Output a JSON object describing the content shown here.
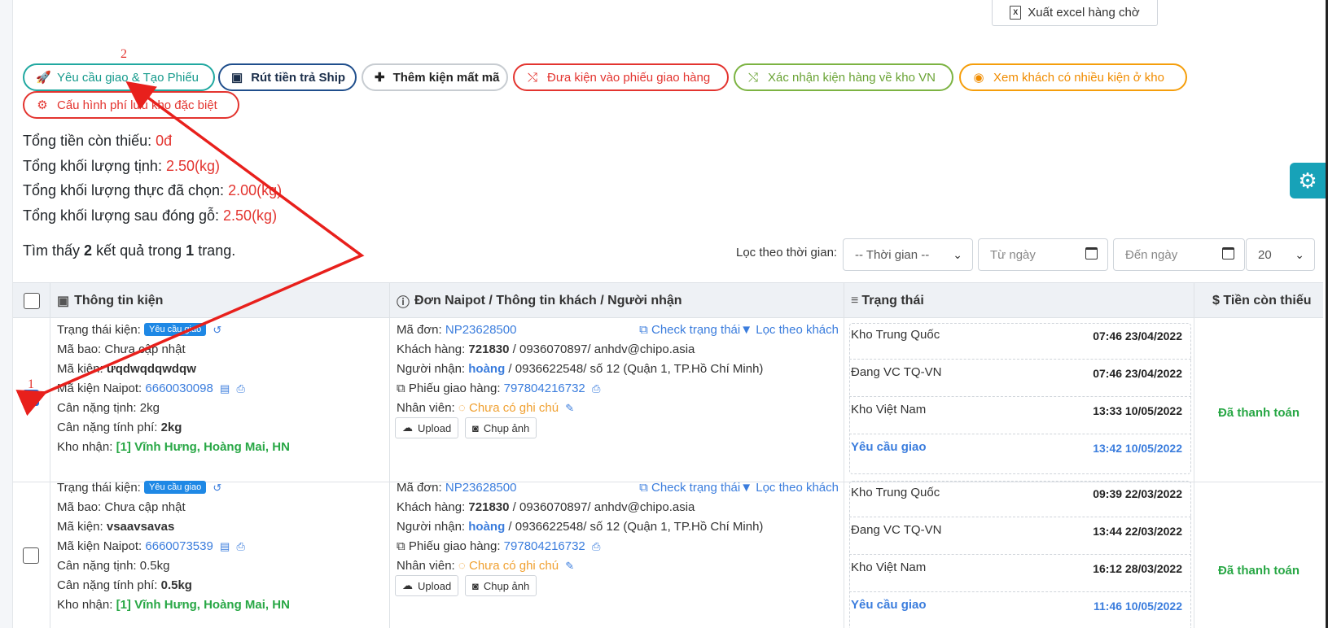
{
  "toolbar": {
    "export_label": "Xuất excel hàng chờ",
    "actions": [
      {
        "label": "Yêu cầu giao & Tạo Phiếu",
        "icon": "rocket-icon"
      },
      {
        "label": "Rút tiền trả Ship",
        "icon": "money-icon"
      },
      {
        "label": "Thêm kiện mất mã",
        "icon": "plus-icon"
      },
      {
        "label": "Đưa kiện vào phiếu giao hàng",
        "icon": "shuffle-icon"
      },
      {
        "label": "Xác nhận kiện hàng về kho VN",
        "icon": "shuffle-icon"
      },
      {
        "label": "Xem khách có nhiều kiện ở kho",
        "icon": "user-circle-icon"
      },
      {
        "label": "Cấu hình phí lưu kho đặc biệt",
        "icon": "gear-icon"
      }
    ]
  },
  "annotations": {
    "step1": "1",
    "step2": "2"
  },
  "summary": {
    "missing_label": "Tổng tiền còn thiếu:",
    "missing_value": "0đ",
    "net_label": "Tổng khối lượng tịnh:",
    "net_value": "2.50(kg)",
    "actual_label": "Tổng khối lượng thực đã chọn:",
    "actual_value": "2.00(kg)",
    "wood_label": "Tổng khối lượng sau đóng gỗ:",
    "wood_value": "2.50(kg)"
  },
  "results": {
    "prefix": "Tìm thấy",
    "count": "2",
    "middle": "kết quả trong",
    "pages": "1",
    "suffix": "trang."
  },
  "filter": {
    "label": "Lọc theo thời gian:",
    "time_select": "-- Thời gian --",
    "from_placeholder": "Từ ngày",
    "to_placeholder": "Đến ngày",
    "page_size": "20"
  },
  "table": {
    "headers": {
      "info": "Thông tin kiện",
      "order": "Đơn Naipot / Thông tin khách / Người nhận",
      "status": "Trạng thái",
      "owed": "$ Tiền còn thiếu"
    },
    "labels": {
      "state": "Trạng thái kiện:",
      "bag": "Mã bao:",
      "code": "Mã kiện:",
      "naipot_code": "Mã kiện Naipot:",
      "net": "Cân nặng tịnh:",
      "charge": "Cân nặng tính phí:",
      "warehouse": "Kho nhận:",
      "order": "Mã đơn:",
      "customer": "Khách hàng:",
      "receiver": "Người nhận:",
      "delivery": "Phiếu giao hàng:",
      "staff": "Nhân viên:",
      "check_status": "Check trạng thái",
      "filter_customer": "Lọc theo khách",
      "upload": "Upload",
      "photo": "Chụp ảnh"
    },
    "rows": [
      {
        "checked": true,
        "badge": "Yêu cầu giao",
        "bag": "Chưa cập nhật",
        "code": "ưqdwqdqwdqw",
        "naipot_code": "6660030098",
        "net": "2kg",
        "charge": "2kg",
        "warehouse": "[1] Vĩnh Hưng, Hoàng Mai, HN",
        "order": "NP23628500",
        "customer_id": "721830",
        "customer_rest": " / 0936070897/ anhdv@chipo.asia",
        "receiver_name": "hoàng",
        "receiver_rest": " / 0936622548/ số 12 (Quận 1, TP.Hồ Chí Minh)",
        "delivery": "797804216732",
        "staff_note": "Chưa có ghi chú",
        "statuses": [
          {
            "name": "Kho Trung Quốc",
            "time": "07:46 23/04/2022"
          },
          {
            "name": "Đang VC TQ-VN",
            "time": "07:46 23/04/2022"
          },
          {
            "name": "Kho Việt Nam",
            "time": "13:33 10/05/2022"
          },
          {
            "name": "Yêu cầu giao",
            "time": "13:42 10/05/2022"
          }
        ],
        "owed": "Đã thanh toán"
      },
      {
        "checked": false,
        "badge": "Yêu cầu giao",
        "bag": "Chưa cập nhật",
        "code": "vsaavsavas",
        "naipot_code": "6660073539",
        "net": "0.5kg",
        "charge": "0.5kg",
        "warehouse": "[1] Vĩnh Hưng, Hoàng Mai, HN",
        "order": "NP23628500",
        "customer_id": "721830",
        "customer_rest": " / 0936070897/ anhdv@chipo.asia",
        "receiver_name": "hoàng",
        "receiver_rest": " / 0936622548/ số 12 (Quận 1, TP.Hồ Chí Minh)",
        "delivery": "797804216732",
        "staff_note": "Chưa có ghi chú",
        "statuses": [
          {
            "name": "Kho Trung Quốc",
            "time": "09:39 22/03/2022"
          },
          {
            "name": "Đang VC TQ-VN",
            "time": "13:44 22/03/2022"
          },
          {
            "name": "Kho Việt Nam",
            "time": "16:12 28/03/2022"
          },
          {
            "name": "Yêu cầu giao",
            "time": "11:46 10/05/2022"
          }
        ],
        "owed": "Đã thanh toán"
      }
    ]
  },
  "colors": {
    "accent": "#20a8a0",
    "danger": "#e3342f",
    "link": "#3b7ddd",
    "success": "#28a745"
  }
}
